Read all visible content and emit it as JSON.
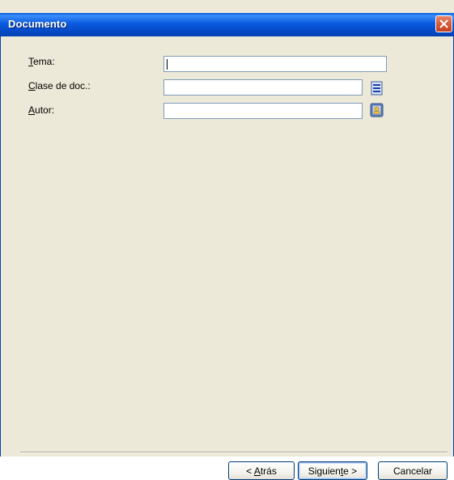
{
  "window": {
    "title": "Documento"
  },
  "form": {
    "tema": {
      "label_accel": "T",
      "label_rest": "ema:",
      "value": ""
    },
    "clase": {
      "label_accel": "C",
      "label_rest": "lase de doc.:",
      "value": "",
      "icon": "list-icon"
    },
    "autor": {
      "label_accel": "A",
      "label_rest": "utor:",
      "value": "",
      "icon": "address-book-icon"
    }
  },
  "footer": {
    "back": {
      "prefix": "< ",
      "accel": "A",
      "rest": "trás"
    },
    "next": {
      "pre": "Siguien",
      "accel": "t",
      "rest": "e >"
    },
    "cancel": {
      "label": "Cancelar"
    }
  },
  "colors": {
    "title_bar": "#0a5ae0",
    "dialog_bg": "#ece9d8",
    "close_button": "#d65a3b"
  }
}
